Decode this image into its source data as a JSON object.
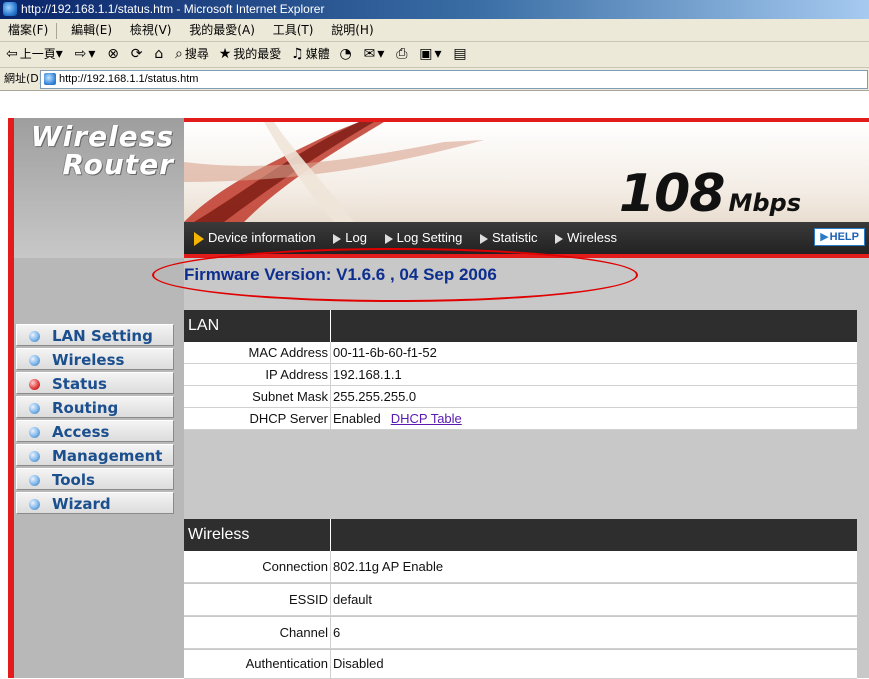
{
  "browser": {
    "title": "http://192.168.1.1/status.htm - Microsoft Internet Explorer",
    "menu": [
      "檔案(F)",
      "編輯(E)",
      "檢視(V)",
      "我的最愛(A)",
      "工具(T)",
      "說明(H)"
    ],
    "toolbar": {
      "back": "上一頁",
      "search": "搜尋",
      "favorites": "我的最愛",
      "media": "媒體"
    },
    "address_label": "網址(D)",
    "address_value": "http://192.168.1.1/status.htm"
  },
  "router": {
    "logo_line1": "Wireless",
    "logo_line2": "Router",
    "speed_value": "108",
    "speed_unit": "Mbps",
    "nav": [
      {
        "label": "LAN Setting",
        "active": false
      },
      {
        "label": "Wireless",
        "active": false
      },
      {
        "label": "Status",
        "active": true
      },
      {
        "label": "Routing",
        "active": false
      },
      {
        "label": "Access",
        "active": false
      },
      {
        "label": "Management",
        "active": false
      },
      {
        "label": "Tools",
        "active": false
      },
      {
        "label": "Wizard",
        "active": false
      }
    ],
    "subnav": [
      "Device information",
      "Log",
      "Log Setting",
      "Statistic",
      "Wireless"
    ],
    "help": "HELP",
    "firmware": "Firmware Version: V1.6.6 , 04 Sep 2006",
    "lan": {
      "heading": "LAN",
      "rows": [
        {
          "label": "MAC Address",
          "value": "00-11-6b-60-f1-52"
        },
        {
          "label": "IP Address",
          "value": "192.168.1.1"
        },
        {
          "label": "Subnet Mask",
          "value": "255.255.255.0"
        },
        {
          "label": "DHCP Server",
          "value": "Enabled",
          "link": "DHCP Table"
        }
      ]
    },
    "wireless": {
      "heading": "Wireless",
      "rows": [
        {
          "label": "Connection",
          "value": "802.11g AP Enable"
        },
        {
          "label": "ESSID",
          "value": "default"
        },
        {
          "label": "Channel",
          "value": "6"
        },
        {
          "label": "Authentication",
          "value": "Disabled"
        }
      ]
    }
  }
}
